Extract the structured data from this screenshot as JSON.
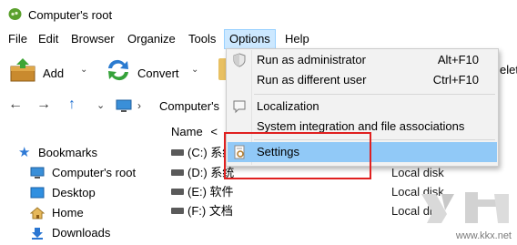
{
  "window": {
    "title": "Computer's root"
  },
  "menubar": {
    "items": [
      {
        "label": "File"
      },
      {
        "label": "Edit"
      },
      {
        "label": "Browser"
      },
      {
        "label": "Organize"
      },
      {
        "label": "Tools"
      },
      {
        "label": "Options"
      },
      {
        "label": "Help"
      }
    ]
  },
  "toolbar": {
    "add_label": "Add",
    "convert_label": "Convert",
    "partial_label": "elete"
  },
  "address": {
    "crumb": "Computer's"
  },
  "leftpane": {
    "items": [
      {
        "label": "Bookmarks"
      },
      {
        "label": "Computer's root"
      },
      {
        "label": "Desktop"
      },
      {
        "label": "Home"
      },
      {
        "label": "Downloads"
      }
    ]
  },
  "filelist": {
    "name_header": "Name",
    "rows": [
      {
        "name": "(C:) 系统",
        "type": ""
      },
      {
        "name": "(D:) 系统",
        "type": "Local disk"
      },
      {
        "name": "(E:) 软件",
        "type": "Local disk"
      },
      {
        "name": "(F:) 文档",
        "type": "Local disk"
      }
    ]
  },
  "options_menu": {
    "items": [
      {
        "label": "Run as administrator",
        "shortcut": "Alt+F10"
      },
      {
        "label": "Run as different user",
        "shortcut": "Ctrl+F10"
      },
      {
        "label": "Localization",
        "shortcut": ""
      },
      {
        "label": "System integration and file associations",
        "shortcut": ""
      },
      {
        "label": "Settings",
        "shortcut": ""
      }
    ],
    "highlighted": "Settings"
  },
  "watermark": {
    "text": "www.kkx.net"
  },
  "colors": {
    "accent_highlight": "#91c9f7",
    "menu_active": "#cce8ff",
    "annotation": "#e02020"
  }
}
